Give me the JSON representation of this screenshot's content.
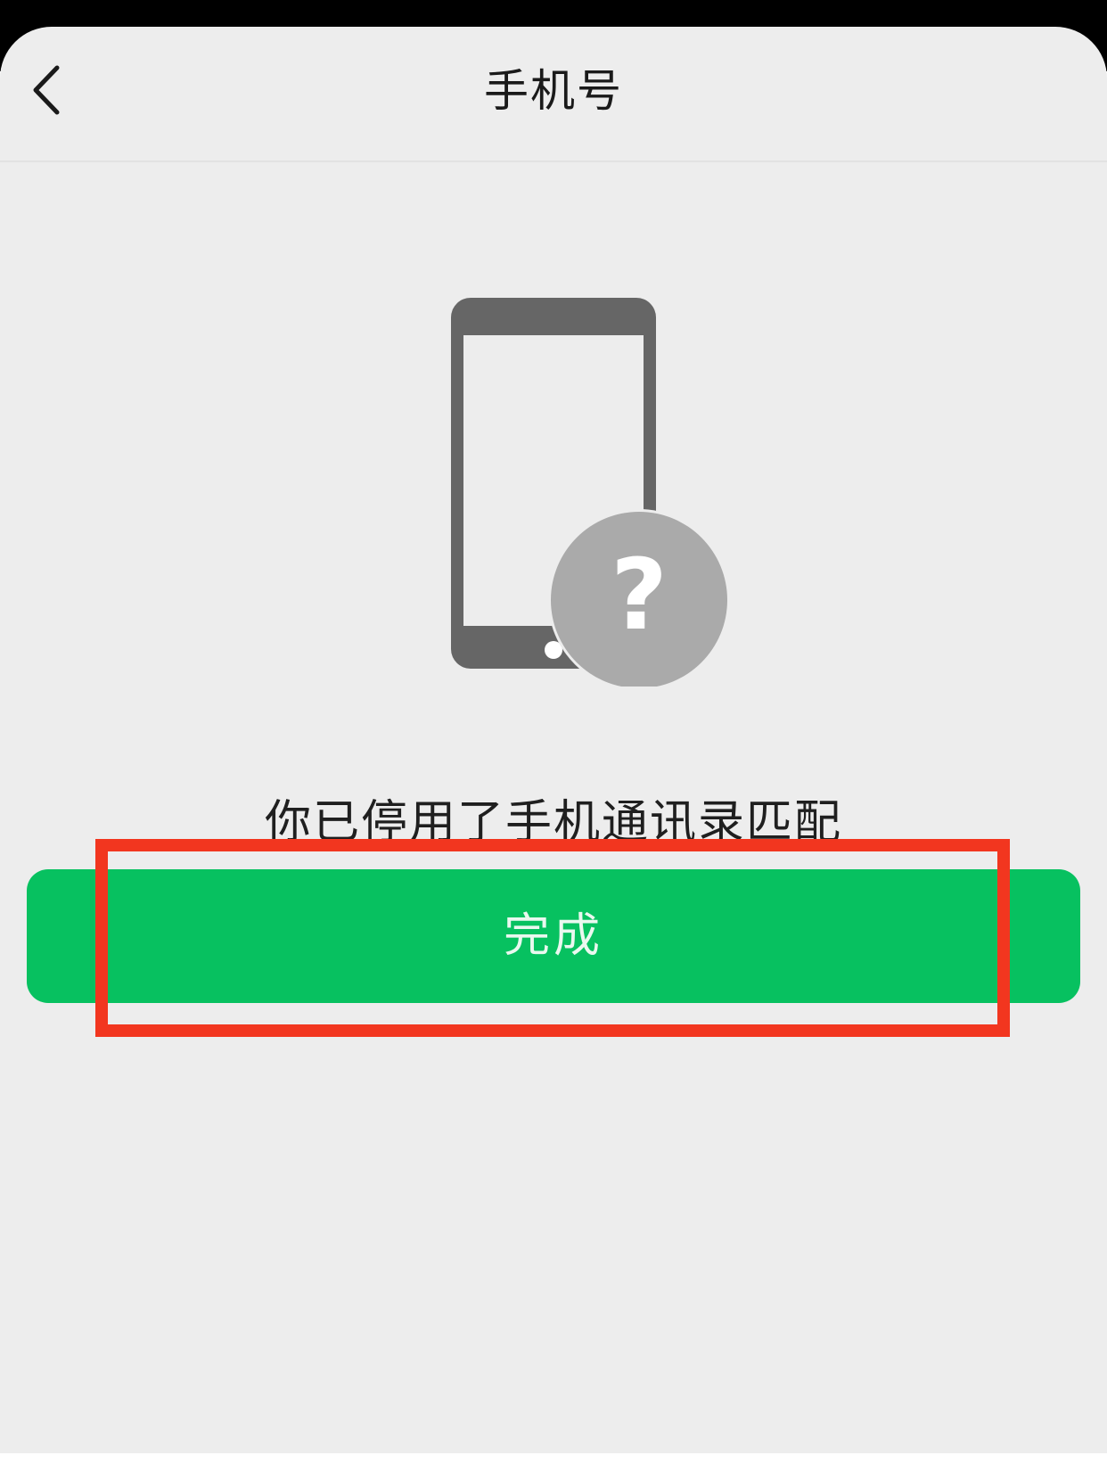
{
  "navbar": {
    "title": "手机号",
    "back_icon": "chevron-left-icon"
  },
  "illustration": {
    "phone_icon": "smartphone-icon",
    "badge_icon": "question-mark-icon",
    "badge_glyph": "?"
  },
  "message": "你已停用了手机通讯录匹配",
  "done_button": {
    "label": "完成"
  },
  "colors": {
    "background": "#ededed",
    "button": "#07c160",
    "button_text": "#eaf8ef",
    "phone": "#666666",
    "badge": "#aaaaaa",
    "highlight": "#f2361f"
  }
}
